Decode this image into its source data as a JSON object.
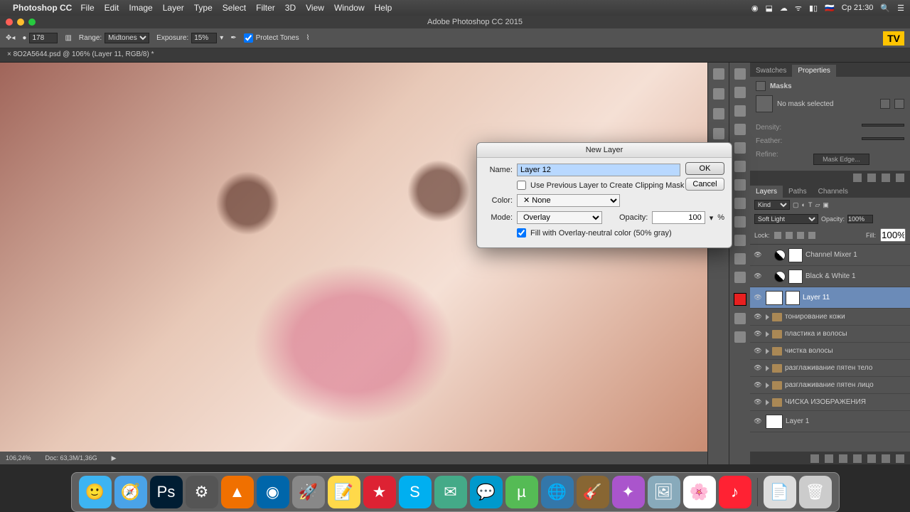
{
  "mac": {
    "app_name": "Photoshop CC",
    "menus": [
      "File",
      "Edit",
      "Image",
      "Layer",
      "Type",
      "Select",
      "Filter",
      "3D",
      "View",
      "Window",
      "Help"
    ],
    "clock": "Ср 21:30"
  },
  "window_title": "Adobe Photoshop CC 2015",
  "option_bar": {
    "brush_size": "178",
    "range_label": "Range:",
    "range_value": "Midtones",
    "exposure_label": "Exposure:",
    "exposure_value": "15%",
    "protect_tones": "Protect Tones",
    "tv": "TV"
  },
  "doc_tab": "8O2A5644.psd @ 106% (Layer 11, RGB/8) *",
  "status": {
    "zoom": "106,24%",
    "docinfo": "Doc: 63,3M/1,36G"
  },
  "props_panel": {
    "tab_swatches": "Swatches",
    "tab_properties": "Properties",
    "masks_label": "Masks",
    "no_mask": "No mask selected",
    "density": "Density:",
    "feather": "Feather:",
    "refine": "Refine:",
    "mask_edge": "Mask Edge..."
  },
  "layers_panel": {
    "tab_layers": "Layers",
    "tab_paths": "Paths",
    "tab_channels": "Channels",
    "filter_kind": "Kind",
    "blend_mode": "Soft Light",
    "opacity_label": "Opacity:",
    "opacity_value": "100%",
    "lock_label": "Lock:",
    "fill_label": "Fill:",
    "fill_value": "100%",
    "layers": [
      {
        "type": "adj",
        "name": "Channel Mixer 1"
      },
      {
        "type": "adj",
        "name": "Black & White 1"
      },
      {
        "type": "layer",
        "name": "Layer 11",
        "selected": true
      },
      {
        "type": "group",
        "name": "тонирование кожи"
      },
      {
        "type": "group",
        "name": "пластика и волосы"
      },
      {
        "type": "group",
        "name": "чистка волосы"
      },
      {
        "type": "group",
        "name": "разглаживание пятен тело"
      },
      {
        "type": "group",
        "name": "разглаживание пятен лицо"
      },
      {
        "type": "group",
        "name": "ЧИСКА ИЗОБРАЖЕНИЯ"
      },
      {
        "type": "layer",
        "name": "Layer 1"
      }
    ]
  },
  "dialog": {
    "title": "New Layer",
    "name_label": "Name:",
    "name_value": "Layer 12",
    "clipmask": "Use Previous Layer to Create Clipping Mask",
    "color_label": "Color:",
    "color_value": "✕ None",
    "mode_label": "Mode:",
    "mode_value": "Overlay",
    "opacity_label": "Opacity:",
    "opacity_value": "100",
    "percent": "%",
    "fill_neutral": "Fill with Overlay-neutral color (50% gray)",
    "ok": "OK",
    "cancel": "Cancel"
  }
}
